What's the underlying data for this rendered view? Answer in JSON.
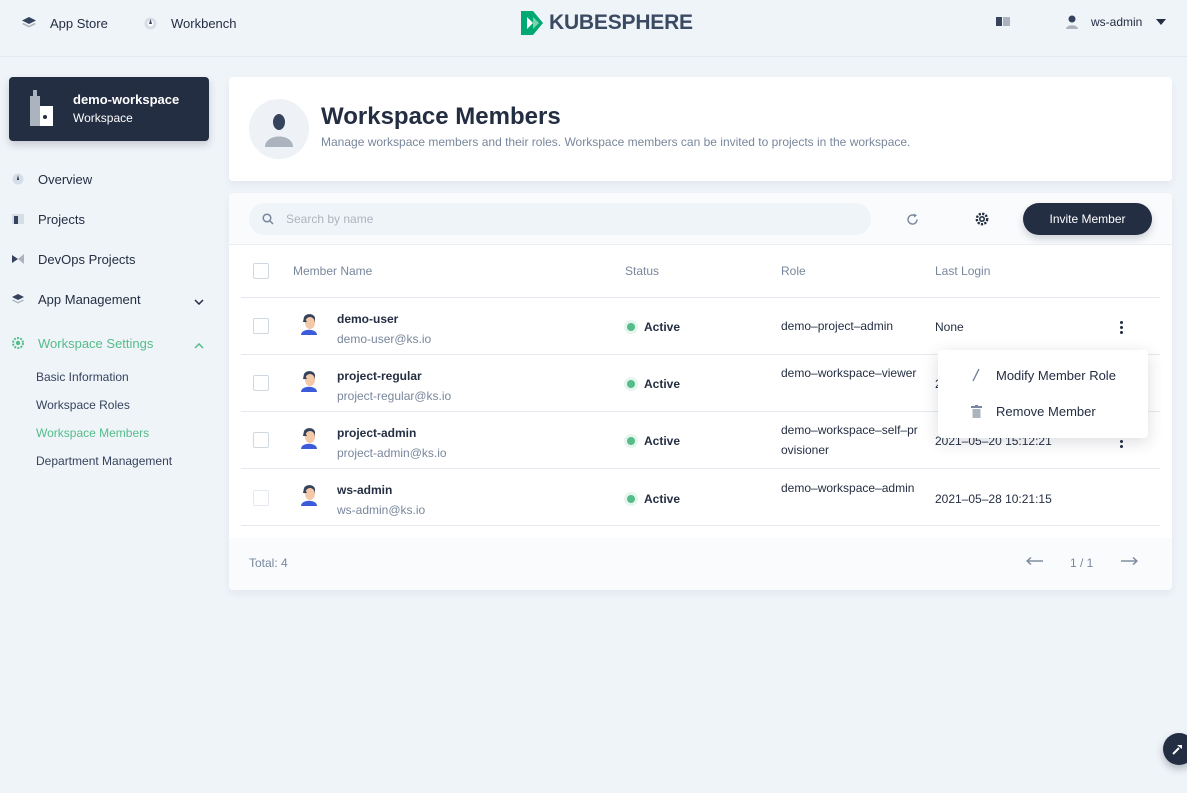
{
  "topbar": {
    "app_store": "App Store",
    "workbench": "Workbench",
    "logo": "KUBESPHERE",
    "user": "ws-admin"
  },
  "sidebar": {
    "workspace_name": "demo-workspace",
    "workspace_type": "Workspace",
    "items": [
      {
        "label": "Overview"
      },
      {
        "label": "Projects"
      },
      {
        "label": "DevOps Projects"
      },
      {
        "label": "App Management"
      },
      {
        "label": "Workspace Settings"
      }
    ],
    "settings_sub": [
      {
        "label": "Basic Information"
      },
      {
        "label": "Workspace Roles"
      },
      {
        "label": "Workspace Members"
      },
      {
        "label": "Department Management"
      }
    ]
  },
  "banner": {
    "title": "Workspace Members",
    "description": "Manage workspace members and their roles. Workspace members can be invited to projects in the workspace."
  },
  "toolbar": {
    "search_placeholder": "Search by name",
    "invite_label": "Invite Member"
  },
  "table": {
    "columns": [
      "Member Name",
      "Status",
      "Role",
      "Last Login"
    ],
    "rows": [
      {
        "name": "demo-user",
        "email": "demo-user@ks.io",
        "status": "Active",
        "role": "demo–project–admin",
        "last_login": "None"
      },
      {
        "name": "project-regular",
        "email": "project-regular@ks.io",
        "status": "Active",
        "role": "demo–workspace–viewer",
        "last_login": "2"
      },
      {
        "name": "project-admin",
        "email": "project-admin@ks.io",
        "status": "Active",
        "role": "demo–workspace–self–provisioner",
        "last_login": "2021–05–20 15:12:21"
      },
      {
        "name": "ws-admin",
        "email": "ws-admin@ks.io",
        "status": "Active",
        "role": "demo–workspace–admin",
        "last_login": "2021–05–28 10:21:15"
      }
    ]
  },
  "footer": {
    "total": "Total: 4",
    "page": "1 / 1"
  },
  "dropdown": {
    "modify": "Modify Member Role",
    "remove": "Remove Member"
  },
  "colors": {
    "accent": "#55bc8a",
    "dark": "#242e42",
    "background": "#eff4f9",
    "muted": "#79879c"
  }
}
